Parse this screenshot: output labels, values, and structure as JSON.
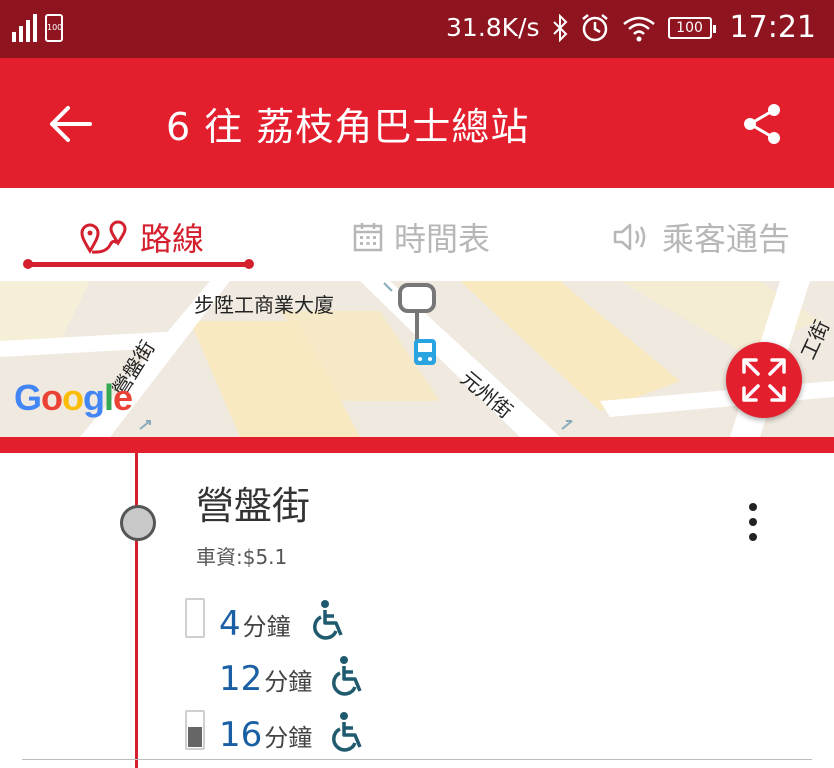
{
  "status_bar": {
    "network_speed": "31.8K/s",
    "battery_small": "100",
    "battery": "100",
    "time": "17:21"
  },
  "app_bar": {
    "title": "6 往 荔枝角巴士總站",
    "back_icon": "arrow-left-icon",
    "share_icon": "share-icon"
  },
  "tabs": [
    {
      "label": "路線",
      "icon": "route-pin-icon",
      "active": true
    },
    {
      "label": "時間表",
      "icon": "calendar-icon",
      "active": false
    },
    {
      "label": "乘客通告",
      "icon": "speaker-icon",
      "active": false
    }
  ],
  "map": {
    "labels": {
      "building": "步陞工商業大廈",
      "street_left": "營盤街",
      "street_center": "元州街",
      "street_right": "工街"
    },
    "attribution": "Google",
    "expand_icon": "expand-icon"
  },
  "stop": {
    "name": "營盤街",
    "fare": "車資:$5.1",
    "etas": [
      {
        "minutes": "4",
        "unit": "分鐘",
        "occupancy": 0.0,
        "wheelchair": true
      },
      {
        "minutes": "12",
        "unit": "分鐘",
        "occupancy": null,
        "wheelchair": true
      },
      {
        "minutes": "16",
        "unit": "分鐘",
        "occupancy": 0.6,
        "wheelchair": true
      }
    ]
  },
  "colors": {
    "status_bar": "#8e1520",
    "primary": "#e31e2d",
    "accent": "#d4202e",
    "eta_number": "#1a5fa3",
    "eta_icon": "#1f5a6e"
  }
}
